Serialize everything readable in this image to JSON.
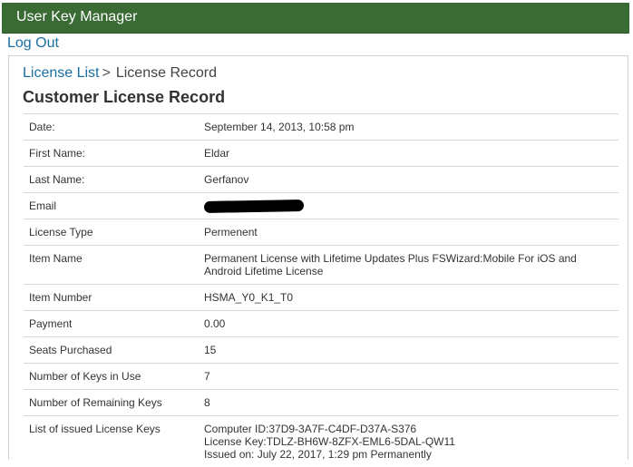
{
  "app": {
    "title": "User Key Manager"
  },
  "header": {
    "logout_label": "Log Out"
  },
  "breadcrumb": {
    "parent": "License List",
    "separator": ">",
    "current": "License Record"
  },
  "page": {
    "title": "Customer License Record"
  },
  "record": {
    "rows": [
      {
        "label": "Date:",
        "value": "September 14, 2013, 10:58 pm"
      },
      {
        "label": "First Name:",
        "value": "Eldar"
      },
      {
        "label": "Last Name:",
        "value": "Gerfanov"
      },
      {
        "label": "Email",
        "value": ""
      },
      {
        "label": "License Type",
        "value": "Permenent"
      },
      {
        "label": "Item Name",
        "value": "Permanent License with Lifetime Updates Plus FSWizard:Mobile For iOS and Android Lifetime License"
      },
      {
        "label": "Item Number",
        "value": "HSMA_Y0_K1_T0"
      },
      {
        "label": "Payment",
        "value": "0.00"
      },
      {
        "label": "Seats Purchased",
        "value": "15"
      },
      {
        "label": "Number of Keys in Use",
        "value": "7"
      },
      {
        "label": "Number of Remaining Keys",
        "value": "8"
      },
      {
        "label": "List of issued License Keys",
        "value": ""
      }
    ],
    "issued_keys": {
      "computer_id": "Computer ID:37D9-3A7F-C4DF-D37A-S376",
      "license_key": "License Key:TDLZ-BH6W-8ZFX-EML6-5DAL-QW11",
      "issued_on": "Issued on: July 22, 2017, 1:29 pm Permanently"
    }
  },
  "colors": {
    "header_bg": "#3a6b35",
    "link": "#1a6fa0"
  }
}
